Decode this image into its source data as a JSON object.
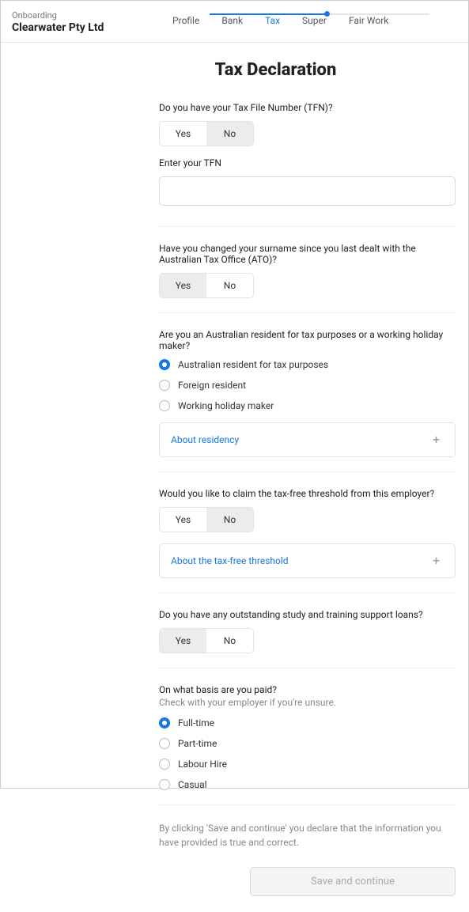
{
  "header": {
    "onboarding": "Onboarding",
    "company": "Clearwater Pty Ltd",
    "steps": [
      "Profile",
      "Bank",
      "Tax",
      "Super",
      "Fair Work"
    ],
    "active_step_index": 2
  },
  "title": "Tax Declaration",
  "tfn": {
    "question": "Do you have your Tax File Number (TFN)?",
    "yes": "Yes",
    "no": "No",
    "selected": "No",
    "input_label": "Enter your TFN",
    "value": ""
  },
  "surname": {
    "question": "Have you changed your surname since you last dealt with the Australian Tax Office (ATO)?",
    "yes": "Yes",
    "no": "No",
    "selected": "Yes"
  },
  "residency": {
    "question": "Are you an Australian resident for tax purposes or a working holiday maker?",
    "options": [
      "Australian resident for tax purposes",
      "Foreign resident",
      "Working holiday maker"
    ],
    "selected_index": 0,
    "expander": "About residency"
  },
  "threshold": {
    "question": "Would you like to claim the tax-free threshold from this employer?",
    "yes": "Yes",
    "no": "No",
    "selected": "No",
    "expander": "About the tax-free threshold"
  },
  "loans": {
    "question": "Do you have any outstanding study and training support loans?",
    "yes": "Yes",
    "no": "No",
    "selected": "Yes"
  },
  "basis": {
    "question": "On what basis are you paid?",
    "sublabel": "Check with your employer if you're unsure.",
    "options": [
      "Full-time",
      "Part-time",
      "Labour Hire",
      "Casual"
    ],
    "selected_index": 0
  },
  "disclaimer": "By clicking 'Save and continue' you declare that the information you have provided is true and correct.",
  "save_label": "Save and continue"
}
